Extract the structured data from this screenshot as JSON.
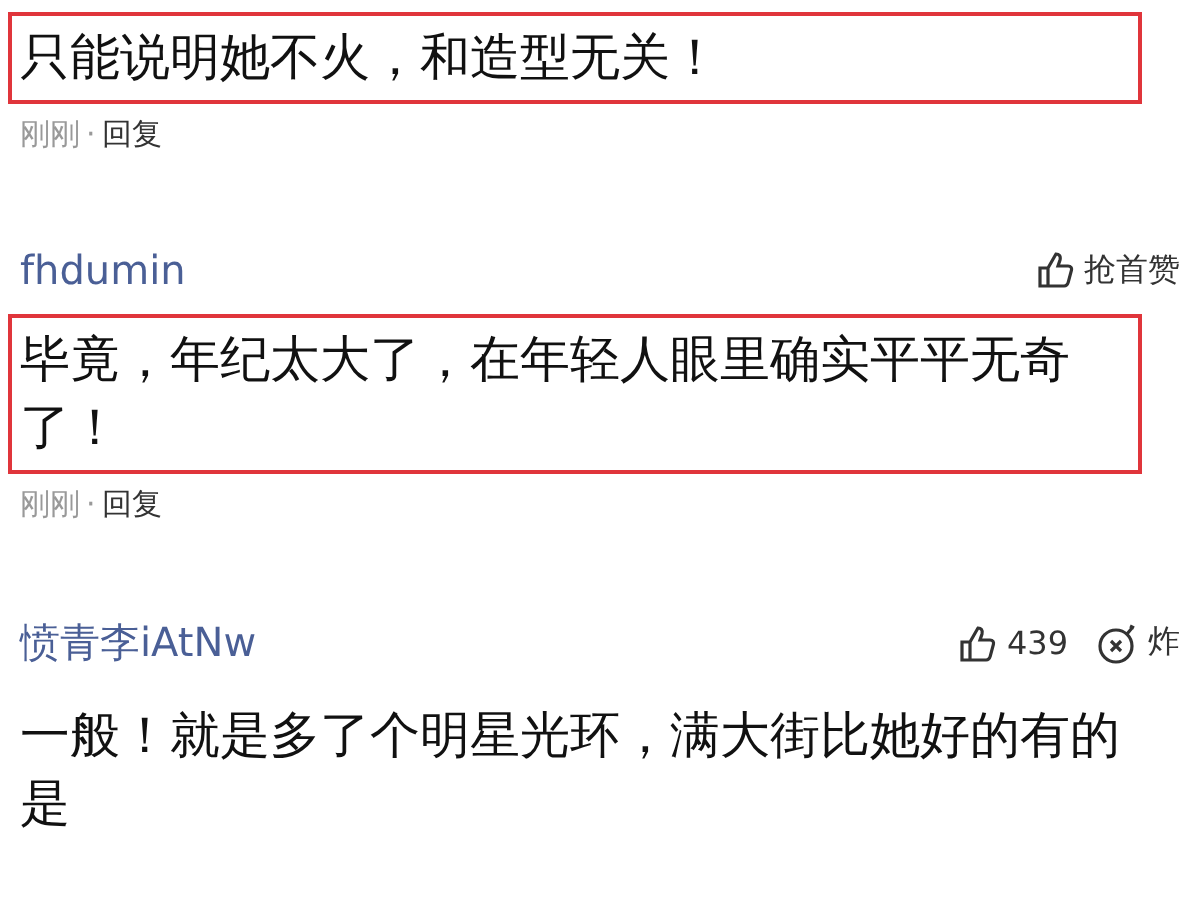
{
  "comments": [
    {
      "highlighted": true,
      "text": "只能说明她不火，和造型无关！",
      "meta": {
        "time": "刚刚",
        "separator": "·",
        "reply": "回复"
      }
    },
    {
      "username": "fhdumin",
      "actions": [
        {
          "kind": "like",
          "label": "抢首赞"
        }
      ],
      "highlighted": true,
      "text": "毕竟，年纪太大了，在年轻人眼里确实平平无奇了！",
      "meta": {
        "time": "刚刚",
        "separator": "·",
        "reply": "回复"
      }
    },
    {
      "username": "愤青李iAtNw",
      "actions": [
        {
          "kind": "like",
          "label": "439"
        },
        {
          "kind": "bomb",
          "label": "炸"
        }
      ],
      "highlighted": false,
      "text": "一般！就是多了个明星光环，满大街比她好的有的是"
    }
  ]
}
